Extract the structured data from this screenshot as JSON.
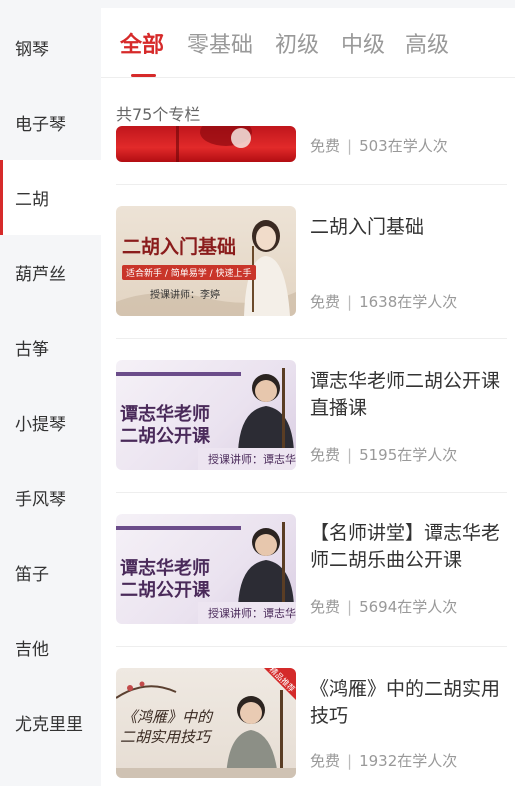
{
  "sidebar": {
    "items": [
      {
        "label": "钢琴"
      },
      {
        "label": "电子琴"
      },
      {
        "label": "二胡"
      },
      {
        "label": "葫芦丝"
      },
      {
        "label": "古筝"
      },
      {
        "label": "小提琴"
      },
      {
        "label": "手风琴"
      },
      {
        "label": "笛子"
      },
      {
        "label": "吉他"
      },
      {
        "label": "尤克里里"
      }
    ],
    "active": "二胡"
  },
  "tabs": [
    {
      "label": "全部"
    },
    {
      "label": "零基础"
    },
    {
      "label": "初级"
    },
    {
      "label": "中级"
    },
    {
      "label": "高级"
    }
  ],
  "active_tab": "全部",
  "list": {
    "count_text": "共75个专栏",
    "items": [
      {
        "title": "",
        "price": "免费",
        "learners": "503在学人次"
      },
      {
        "title": "二胡入门基础",
        "price": "免费",
        "learners": "1638在学人次",
        "thumb": {
          "heading": "二胡入门基础",
          "tagline": "适合新手 / 简单易学 / 快速上手",
          "teacher": "授课讲师：李婷"
        }
      },
      {
        "title": "谭志华老师二胡公开课直播课",
        "price": "免费",
        "learners": "5195在学人次",
        "thumb": {
          "line1": "谭志华老师",
          "line2": "二胡公开课",
          "teacher": "授课讲师：谭志华"
        }
      },
      {
        "title": "【名师讲堂】谭志华老师二胡乐曲公开课",
        "price": "免费",
        "learners": "5694在学人次",
        "thumb": {
          "line1": "谭志华老师",
          "line2": "二胡公开课",
          "teacher": "授课讲师：谭志华"
        }
      },
      {
        "title": "《鸿雁》中的二胡实用技巧",
        "price": "免费",
        "learners": "1932在学人次",
        "thumb": {
          "line1": "《鸿雁》中的",
          "line2": "二胡实用技巧",
          "ribbon": "精品推荐"
        }
      }
    ]
  },
  "colors": {
    "accent": "#d62a2a",
    "muted": "#999999",
    "sidebar_bg": "#f5f6f8"
  }
}
